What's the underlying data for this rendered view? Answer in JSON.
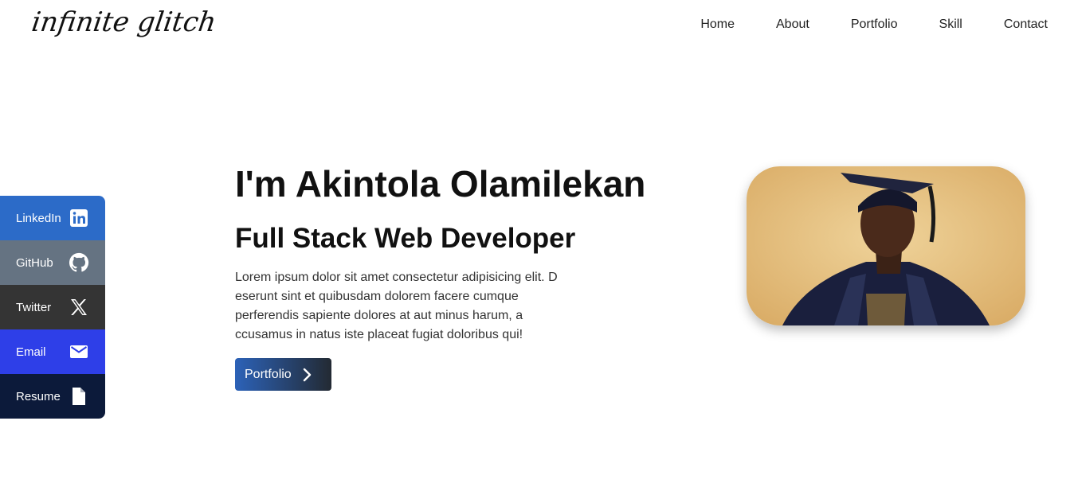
{
  "brand": {
    "logo_text": "infinite glitch"
  },
  "nav": {
    "items": [
      {
        "label": "Home"
      },
      {
        "label": "About"
      },
      {
        "label": "Portfolio"
      },
      {
        "label": "Skill"
      },
      {
        "label": "Contact"
      }
    ]
  },
  "social": {
    "items": [
      {
        "label": "LinkedIn",
        "icon": "linkedin-icon",
        "color": "#2c6bc8"
      },
      {
        "label": "GitHub",
        "icon": "github-icon",
        "color": "#657382"
      },
      {
        "label": "Twitter",
        "icon": "x-icon",
        "color": "#343434"
      },
      {
        "label": "Email",
        "icon": "mail-icon",
        "color": "#2e3fe8"
      },
      {
        "label": "Resume",
        "icon": "file-icon",
        "color": "#0c1a3a"
      }
    ]
  },
  "hero": {
    "heading": "I'm Akintola Olamilekan",
    "subheading": "Full Stack Web Developer",
    "description": "Lorem ipsum dolor sit amet consectetur adipisicing elit. D eserunt sint et quibusdam dolorem facere cumque perferendis sapiente dolores at aut minus harum, a ccusamus in natus iste placeat fugiat doloribus qui!",
    "button_label": "Portfolio",
    "button_icon": "chevron-right-icon",
    "button_gradient": [
      "#2c62b8",
      "#232a33"
    ]
  },
  "photo": {
    "subject": "portrait-photo"
  }
}
